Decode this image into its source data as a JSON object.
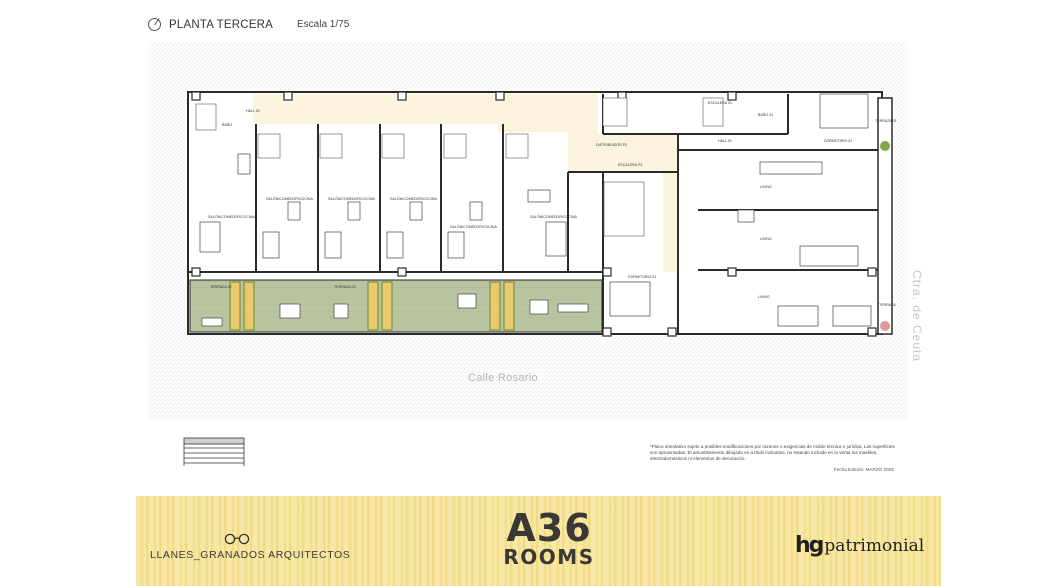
{
  "header": {
    "title": "PLANTA TERCERA",
    "scale": "Escala 1/75"
  },
  "plan": {
    "room_labels": {
      "hall_02": "HALL 02",
      "bano": "BAÑO",
      "salon_comedor_cocina": "SALÓN/COMEDOR/COCINA",
      "hall_01": "HALL 01",
      "escalera_01": "ESCALERA 01",
      "distribuidor_p3": "DISTRIBUIDOR P3",
      "escalera_p3": "ESCALERA P3",
      "dormitorio_01": "DORMITORIO 01",
      "bano_01": "BAÑO 01",
      "living": "LIVING",
      "terraza_01": "TERRAZA 01",
      "terraza_02": "TERRAZA 02",
      "terraza_03": "TERRAZA 03",
      "terraza": "TERRAZA"
    },
    "street": "Calle Rosario",
    "side_street": "Ctra. de Ceuta"
  },
  "notes": {
    "disclaimer": "*Plano orientativo sujeto a posibles modificaciones por razones o exigencias de índole técnica o jurídica. Las superficies son aproximadas. El amueblamiento dibujado es a título indicativo, no estando incluido en la venta los muebles, electrodomésticos ni elementos de decoración.",
    "edition": "Fecha Edición: MARZO 2026"
  },
  "footer": {
    "architects": "LLANES_GRANADOS ARQUITECTOS",
    "brand_line1": "A36",
    "brand_line2": "ROOMS",
    "partner_mark": "hg",
    "partner_name": "patrimonial"
  },
  "colors": {
    "banner": "#f5e196",
    "terrace": "#b9c4a0",
    "corridor": "#fbf3dc",
    "wall": "#2a2a2a"
  }
}
